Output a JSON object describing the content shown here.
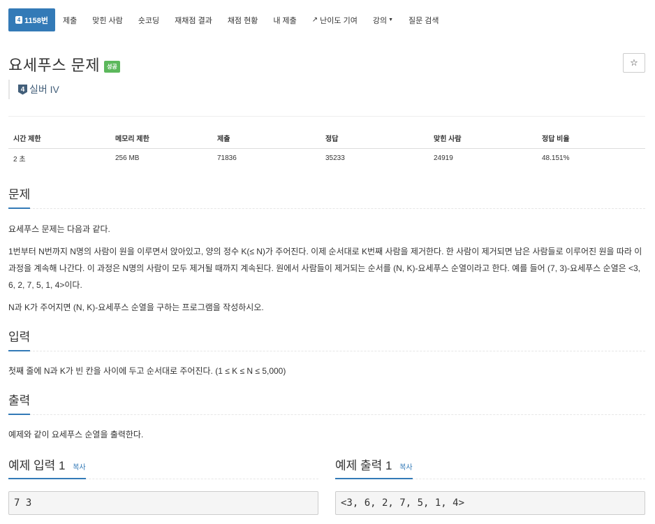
{
  "nav": {
    "problem_tab": {
      "tier": "4",
      "label": "1158번"
    },
    "items": [
      {
        "name": "tab-submit",
        "label": "제출"
      },
      {
        "name": "tab-solvers",
        "label": "맞힌 사람"
      },
      {
        "name": "tab-shortcoding",
        "label": "숏코딩"
      },
      {
        "name": "tab-rejudge",
        "label": "재채점 결과"
      },
      {
        "name": "tab-status",
        "label": "채점 현황"
      },
      {
        "name": "tab-my-submissions",
        "label": "내 제출"
      },
      {
        "name": "tab-difficulty",
        "label": "난이도 기여",
        "icon": "external-link-icon"
      },
      {
        "name": "tab-lectures",
        "label": "강의",
        "dropdown": true
      },
      {
        "name": "tab-questions",
        "label": "질문 검색"
      }
    ]
  },
  "problem": {
    "title": "요세푸스 문제",
    "result_badge": "성공",
    "result_color": "#5cb85c",
    "star_icon": "star-icon",
    "tier_number": "4",
    "tier_label": "실버 IV",
    "tier_color": "#435f7a"
  },
  "info_table": {
    "headers": [
      "시간 제한",
      "메모리 제한",
      "제출",
      "정답",
      "맞힌 사람",
      "정답 비율"
    ],
    "values": [
      "2 초",
      "256 MB",
      "71836",
      "35233",
      "24919",
      "48.151%"
    ]
  },
  "sections": {
    "description": {
      "heading": "문제",
      "paragraphs": [
        "요세푸스 문제는 다음과 같다.",
        "1번부터 N번까지 N명의 사람이 원을 이루면서 앉아있고, 양의 정수 K(≤ N)가 주어진다. 이제 순서대로 K번째 사람을 제거한다. 한 사람이 제거되면 남은 사람들로 이루어진 원을 따라 이 과정을 계속해 나간다. 이 과정은 N명의 사람이 모두 제거될 때까지 계속된다. 원에서 사람들이 제거되는 순서를 (N, K)-요세푸스 순열이라고 한다. 예를 들어 (7, 3)-요세푸스 순열은 <3, 6, 2, 7, 5, 1, 4>이다.",
        "N과 K가 주어지면 (N, K)-요세푸스 순열을 구하는 프로그램을 작성하시오."
      ]
    },
    "input": {
      "heading": "입력",
      "text": "첫째 줄에 N과 K가 빈 칸을 사이에 두고 순서대로 주어진다. (1 ≤ K ≤ N ≤ 5,000)"
    },
    "output": {
      "heading": "출력",
      "text": "예제와 같이 요세푸스 순열을 출력한다."
    }
  },
  "samples": {
    "input": {
      "heading": "예제 입력 1",
      "copy_label": "복사",
      "content": "7 3"
    },
    "output": {
      "heading": "예제 출력 1",
      "copy_label": "복사",
      "content": "<3, 6, 2, 7, 5, 1, 4>"
    }
  },
  "accent_color": "#337ab7"
}
